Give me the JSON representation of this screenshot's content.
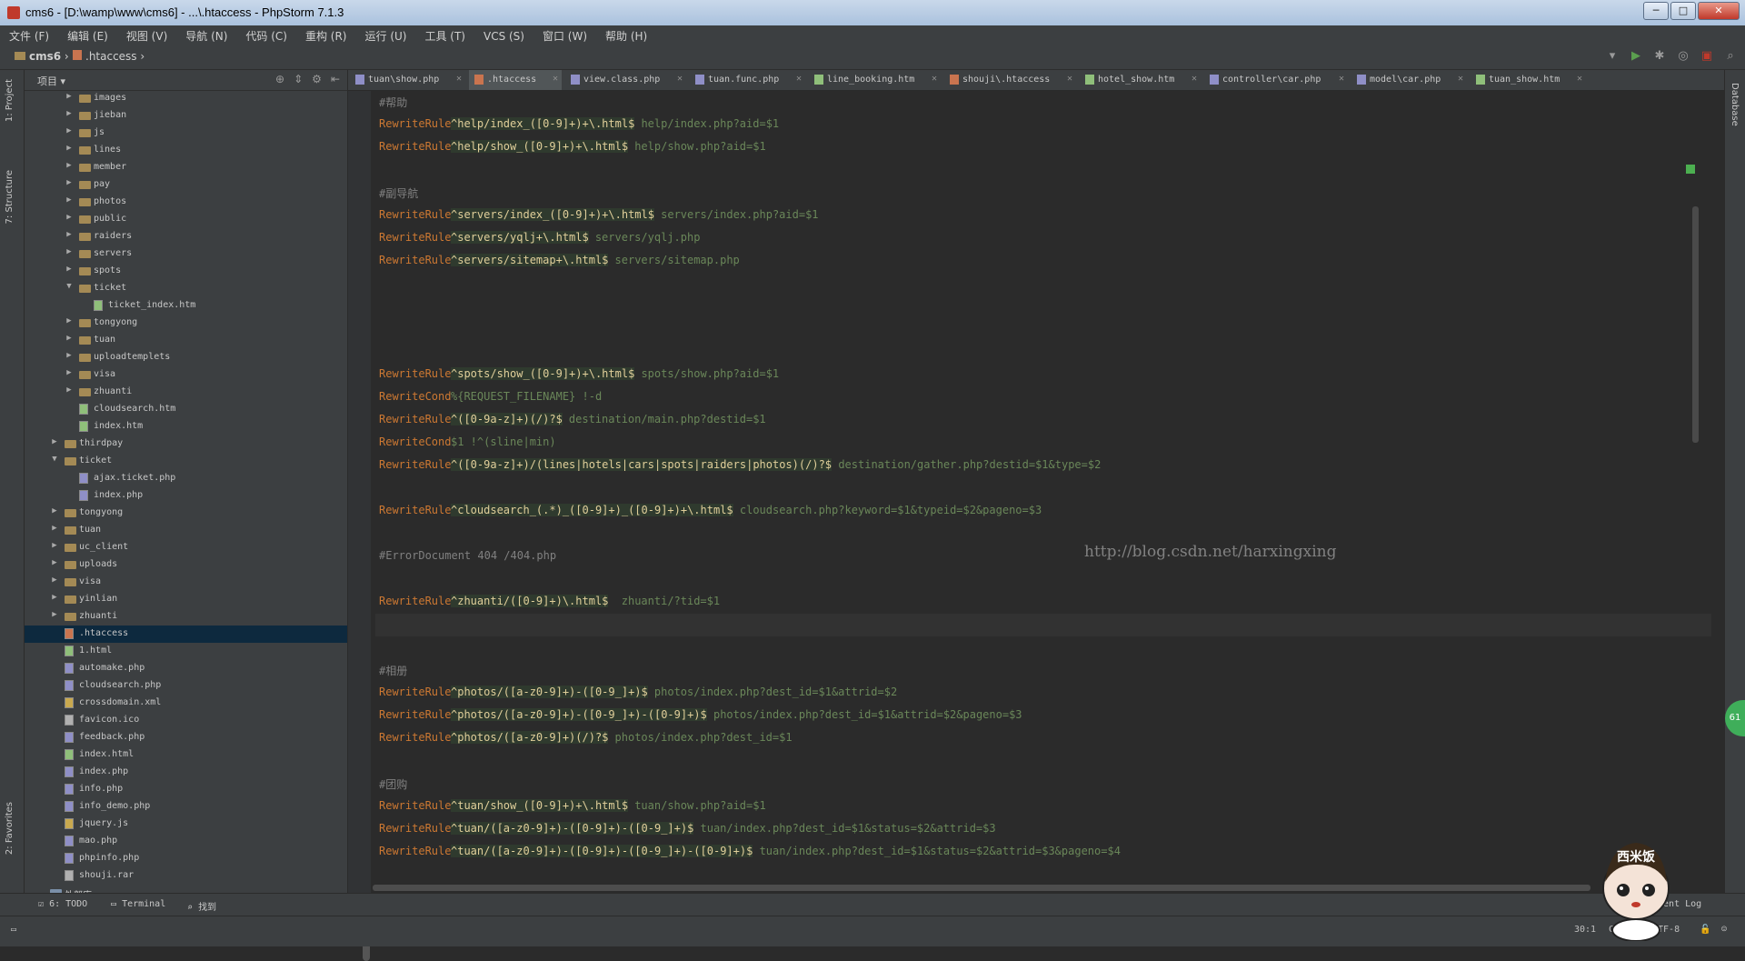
{
  "window": {
    "title": "cms6 - [D:\\wamp\\www\\cms6] - ...\\.htaccess - PhpStorm 7.1.3"
  },
  "menu": [
    "文件 (F)",
    "编辑 (E)",
    "视图 (V)",
    "导航 (N)",
    "代码 (C)",
    "重构 (R)",
    "运行 (U)",
    "工具 (T)",
    "VCS (S)",
    "窗口 (W)",
    "帮助 (H)"
  ],
  "breadcrumb": {
    "project": "cms6",
    "file": ".htaccess"
  },
  "left_strip": {
    "project": "1: Project",
    "structure": "7: Structure",
    "favorites": "2: Favorites"
  },
  "right_strip": {
    "database": "Database"
  },
  "project_panel": {
    "title": "项目"
  },
  "tree": [
    {
      "label": "images",
      "type": "folder",
      "indent": 2,
      "arrow": "▶"
    },
    {
      "label": "jieban",
      "type": "folder",
      "indent": 2,
      "arrow": "▶"
    },
    {
      "label": "js",
      "type": "folder",
      "indent": 2,
      "arrow": "▶"
    },
    {
      "label": "lines",
      "type": "folder",
      "indent": 2,
      "arrow": "▶"
    },
    {
      "label": "member",
      "type": "folder",
      "indent": 2,
      "arrow": "▶"
    },
    {
      "label": "pay",
      "type": "folder",
      "indent": 2,
      "arrow": "▶"
    },
    {
      "label": "photos",
      "type": "folder",
      "indent": 2,
      "arrow": "▶"
    },
    {
      "label": "public",
      "type": "folder",
      "indent": 2,
      "arrow": "▶"
    },
    {
      "label": "raiders",
      "type": "folder",
      "indent": 2,
      "arrow": "▶"
    },
    {
      "label": "servers",
      "type": "folder",
      "indent": 2,
      "arrow": "▶"
    },
    {
      "label": "spots",
      "type": "folder",
      "indent": 2,
      "arrow": "▶"
    },
    {
      "label": "ticket",
      "type": "folder",
      "indent": 2,
      "arrow": "▼"
    },
    {
      "label": "ticket_index.htm",
      "type": "htm",
      "indent": 3,
      "arrow": ""
    },
    {
      "label": "tongyong",
      "type": "folder",
      "indent": 2,
      "arrow": "▶"
    },
    {
      "label": "tuan",
      "type": "folder",
      "indent": 2,
      "arrow": "▶"
    },
    {
      "label": "uploadtemplets",
      "type": "folder",
      "indent": 2,
      "arrow": "▶"
    },
    {
      "label": "visa",
      "type": "folder",
      "indent": 2,
      "arrow": "▶"
    },
    {
      "label": "zhuanti",
      "type": "folder",
      "indent": 2,
      "arrow": "▶"
    },
    {
      "label": "cloudsearch.htm",
      "type": "htm",
      "indent": 2,
      "arrow": ""
    },
    {
      "label": "index.htm",
      "type": "htm",
      "indent": 2,
      "arrow": ""
    },
    {
      "label": "thirdpay",
      "type": "folder",
      "indent": 1,
      "arrow": "▶"
    },
    {
      "label": "ticket",
      "type": "folder",
      "indent": 1,
      "arrow": "▼"
    },
    {
      "label": "ajax.ticket.php",
      "type": "php",
      "indent": 2,
      "arrow": ""
    },
    {
      "label": "index.php",
      "type": "php",
      "indent": 2,
      "arrow": ""
    },
    {
      "label": "tongyong",
      "type": "folder",
      "indent": 1,
      "arrow": "▶"
    },
    {
      "label": "tuan",
      "type": "folder",
      "indent": 1,
      "arrow": "▶"
    },
    {
      "label": "uc_client",
      "type": "folder",
      "indent": 1,
      "arrow": "▶"
    },
    {
      "label": "uploads",
      "type": "folder",
      "indent": 1,
      "arrow": "▶"
    },
    {
      "label": "visa",
      "type": "folder",
      "indent": 1,
      "arrow": "▶"
    },
    {
      "label": "yinlian",
      "type": "folder",
      "indent": 1,
      "arrow": "▶"
    },
    {
      "label": "zhuanti",
      "type": "folder",
      "indent": 1,
      "arrow": "▶"
    },
    {
      "label": ".htaccess",
      "type": "hta",
      "indent": 1,
      "arrow": "",
      "selected": true
    },
    {
      "label": "1.html",
      "type": "htm",
      "indent": 1,
      "arrow": ""
    },
    {
      "label": "automake.php",
      "type": "php",
      "indent": 1,
      "arrow": ""
    },
    {
      "label": "cloudsearch.php",
      "type": "php",
      "indent": 1,
      "arrow": ""
    },
    {
      "label": "crossdomain.xml",
      "type": "js",
      "indent": 1,
      "arrow": ""
    },
    {
      "label": "favicon.ico",
      "type": "gen",
      "indent": 1,
      "arrow": ""
    },
    {
      "label": "feedback.php",
      "type": "php",
      "indent": 1,
      "arrow": ""
    },
    {
      "label": "index.html",
      "type": "htm",
      "indent": 1,
      "arrow": ""
    },
    {
      "label": "index.php",
      "type": "php",
      "indent": 1,
      "arrow": ""
    },
    {
      "label": "info.php",
      "type": "php",
      "indent": 1,
      "arrow": ""
    },
    {
      "label": "info_demo.php",
      "type": "php",
      "indent": 1,
      "arrow": ""
    },
    {
      "label": "jquery.js",
      "type": "js",
      "indent": 1,
      "arrow": ""
    },
    {
      "label": "mao.php",
      "type": "php",
      "indent": 1,
      "arrow": ""
    },
    {
      "label": "phpinfo.php",
      "type": "php",
      "indent": 1,
      "arrow": ""
    },
    {
      "label": "shouji.rar",
      "type": "gen",
      "indent": 1,
      "arrow": ""
    },
    {
      "label": "外部库",
      "type": "lib",
      "indent": 0,
      "arrow": ""
    }
  ],
  "tabs": [
    {
      "label": "tuan\\show.php",
      "kind": "php"
    },
    {
      "label": ".htaccess",
      "kind": "hta",
      "active": true
    },
    {
      "label": "view.class.php",
      "kind": "php"
    },
    {
      "label": "tuan.func.php",
      "kind": "php"
    },
    {
      "label": "line_booking.htm",
      "kind": "htm"
    },
    {
      "label": "shouji\\.htaccess",
      "kind": "hta"
    },
    {
      "label": "hotel_show.htm",
      "kind": "htm"
    },
    {
      "label": "controller\\car.php",
      "kind": "php"
    },
    {
      "label": "model\\car.php",
      "kind": "php"
    },
    {
      "label": "tuan_show.htm",
      "kind": "htm"
    }
  ],
  "code": [
    {
      "c": "#帮助"
    },
    {
      "k": "RewriteRule",
      "p": "^help/index_([0-9]+)+\\.html$",
      "t": "help/index.php?aid=$1"
    },
    {
      "k": "RewriteRule",
      "p": "^help/show_([0-9]+)+\\.html$",
      "t": "help/show.php?aid=$1"
    },
    {},
    {
      "c": "#副导航"
    },
    {
      "k": "RewriteRule",
      "p": "^servers/index_([0-9]+)+\\.html$",
      "t": "servers/index.php?aid=$1"
    },
    {
      "k": "RewriteRule",
      "p": "^servers/yqlj+\\.html$",
      "t": "servers/yqlj.php"
    },
    {
      "k": "RewriteRule",
      "p": "^servers/sitemap+\\.html$",
      "t": "servers/sitemap.php"
    },
    {},
    {},
    {},
    {},
    {
      "k": "RewriteRule",
      "p": "^spots/show_([0-9]+)+\\.html$",
      "t": "spots/show.php?aid=$1"
    },
    {
      "k": "RewriteCond",
      "p": "",
      "t": "%{REQUEST_FILENAME} !-d"
    },
    {
      "k": "RewriteRule",
      "p": "^([0-9a-z]+)(/)?$",
      "t": "destination/main.php?destid=$1"
    },
    {
      "k": "RewriteCond",
      "p": "",
      "t": "$1 !^(sline|min)"
    },
    {
      "k": "RewriteRule",
      "p": "^([0-9a-z]+)/(lines|hotels|cars|spots|raiders|photos)(/)?$",
      "t": "destination/gather.php?destid=$1&type=$2"
    },
    {},
    {
      "k": "RewriteRule",
      "p": "^cloudsearch_(.*)_([0-9]+)_([0-9]+)+\\.html$",
      "t": "cloudsearch.php?keyword=$1&typeid=$2&pageno=$3"
    },
    {},
    {
      "c": "#ErrorDocument 404 /404.php"
    },
    {},
    {
      "k": "RewriteRule",
      "p": "^zhuanti/([0-9]+)\\.html$",
      "t": " zhuanti/?tid=$1"
    },
    {
      "cur": true
    },
    {},
    {
      "c": "#相册"
    },
    {
      "k": "RewriteRule",
      "p": "^photos/([a-z0-9]+)-([0-9_]+)$",
      "t": "photos/index.php?dest_id=$1&attrid=$2"
    },
    {
      "k": "RewriteRule",
      "p": "^photos/([a-z0-9]+)-([0-9_]+)-([0-9]+)$",
      "t": "photos/index.php?dest_id=$1&attrid=$2&pageno=$3"
    },
    {
      "k": "RewriteRule",
      "p": "^photos/([a-z0-9]+)(/)?$",
      "t": "photos/index.php?dest_id=$1"
    },
    {},
    {
      "c": "#团购"
    },
    {
      "k": "RewriteRule",
      "p": "^tuan/show_([0-9]+)+\\.html$",
      "t": "tuan/show.php?aid=$1"
    },
    {
      "k": "RewriteRule",
      "p": "^tuan/([a-z0-9]+)-([0-9]+)-([0-9_]+)$",
      "t": "tuan/index.php?dest_id=$1&status=$2&attrid=$3"
    },
    {
      "k": "RewriteRule",
      "p": "^tuan/([a-z0-9]+)-([0-9]+)-([0-9_]+)-([0-9]+)$",
      "t": "tuan/index.php?dest_id=$1&status=$2&attrid=$3&pageno=$4"
    }
  ],
  "watermark": "http://blog.csdn.net/harxingxing",
  "bottom_tools": {
    "todo": "6: TODO",
    "terminal": "Terminal",
    "find": "找到",
    "event_log": "Event Log"
  },
  "status": {
    "position": "30:1",
    "crlf": "CRLF",
    "encoding": "UTF-8"
  },
  "bubble": "61",
  "mascot_text": "西米饭",
  "colors": {
    "keyword": "#cc7832",
    "pattern": "#e0cf9a",
    "target": "#6a8759",
    "comment": "#808080",
    "selection": "#0d293e"
  }
}
